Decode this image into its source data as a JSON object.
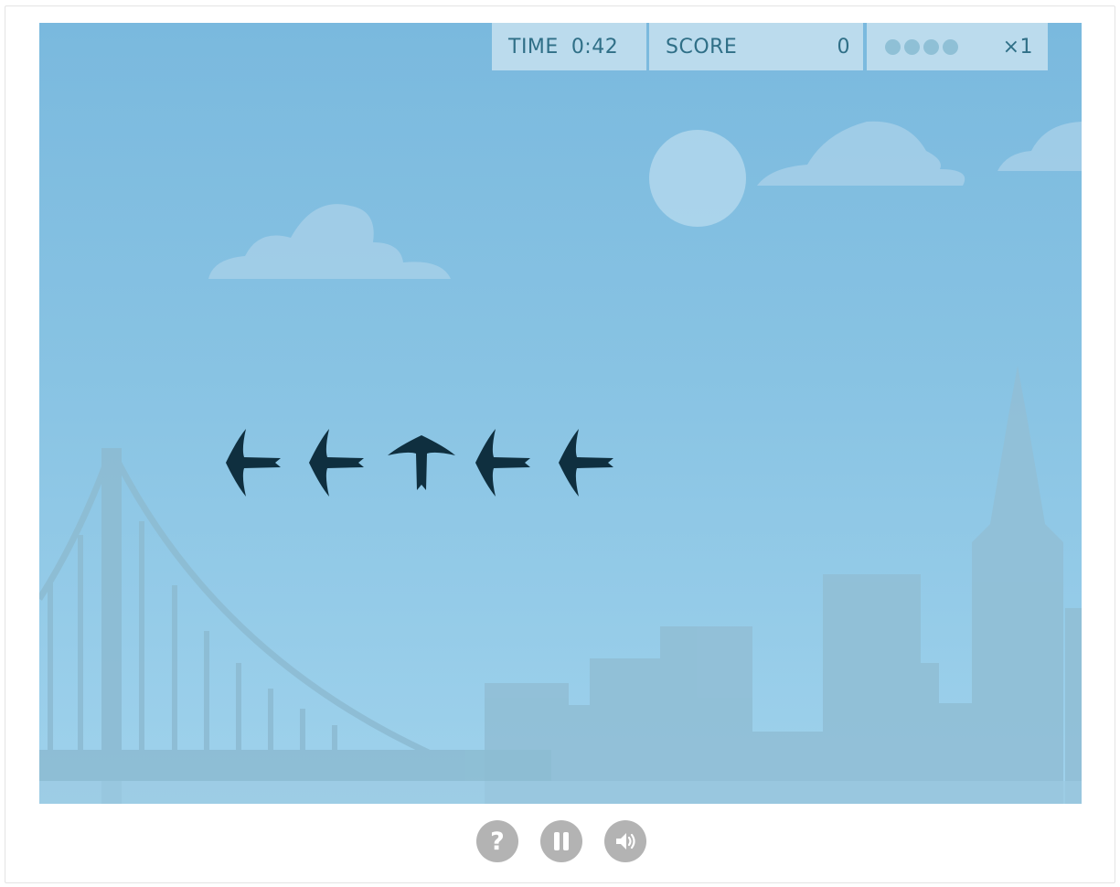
{
  "hud": {
    "time_label": "TIME",
    "time_value": "0:42",
    "score_label": "SCORE",
    "score_value": "0",
    "streak_dots_filled": 0,
    "streak_dots_total": 4,
    "multiplier": "×1"
  },
  "birds": [
    {
      "direction": "left",
      "icon": "bird-left-icon"
    },
    {
      "direction": "left",
      "icon": "bird-left-icon"
    },
    {
      "direction": "up",
      "icon": "bird-up-icon"
    },
    {
      "direction": "left",
      "icon": "bird-left-icon"
    },
    {
      "direction": "left",
      "icon": "bird-left-icon"
    }
  ],
  "controls": [
    {
      "name": "help-button",
      "icon": "question-icon",
      "glyph": "?"
    },
    {
      "name": "pause-button",
      "icon": "pause-icon"
    },
    {
      "name": "sound-button",
      "icon": "speaker-icon"
    }
  ],
  "colors": {
    "bird": "#0f2f3f",
    "hud_text": "#2f6f87",
    "control_bg": "#b3b3b3"
  }
}
